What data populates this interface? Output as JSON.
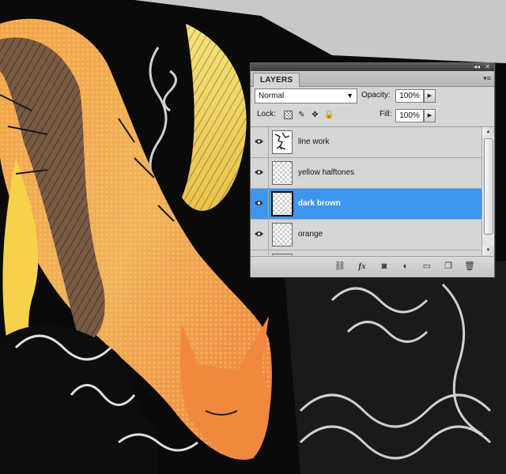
{
  "panel": {
    "tab_title": "LAYERS",
    "blend_mode": "Normal",
    "opacity_label": "Opacity:",
    "opacity_value": "100%",
    "lock_label": "Lock:",
    "fill_label": "Fill:",
    "fill_value": "100%",
    "layers": [
      {
        "name": "line work",
        "visible": true,
        "selected": false
      },
      {
        "name": "yellow halftones",
        "visible": true,
        "selected": false
      },
      {
        "name": "dark brown",
        "visible": true,
        "selected": true
      },
      {
        "name": "orange",
        "visible": true,
        "selected": false
      }
    ],
    "icons": {
      "collapse": "collapse-panel-icon",
      "close": "close-panel-icon",
      "menu": "panel-menu-icon",
      "lock": [
        "lock-transparent-pixels-icon",
        "lock-image-pixels-icon",
        "lock-position-icon",
        "lock-all-icon"
      ],
      "bottom": [
        "link-layers-icon",
        "layer-style-icon",
        "add-mask-icon",
        "adjustment-layer-icon",
        "new-group-icon",
        "new-layer-icon",
        "delete-layer-icon"
      ]
    }
  },
  "colors": {
    "selection": "#3d95f0",
    "panel_bg": "#d6d6d6"
  }
}
